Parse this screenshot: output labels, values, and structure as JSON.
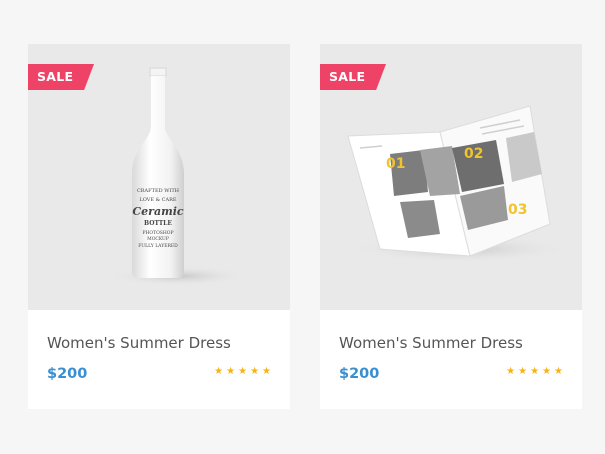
{
  "products": [
    {
      "badge": "SALE",
      "title": "Women's Summer Dress",
      "price": "$200",
      "rating": 5,
      "image": {
        "subject": "ceramic-bottle-mockup",
        "label_lines": [
          "CRAFTED WITH",
          "LOVE & CARE",
          "Ceramic",
          "BOTTLE",
          "PHOTOSHOP",
          "MOCKUP",
          "FULLY LAYERED"
        ]
      }
    },
    {
      "badge": "SALE",
      "title": "Women's Summer Dress",
      "price": "$200",
      "rating": 5,
      "image": {
        "subject": "open-magazine-mockup",
        "numbers": [
          "01",
          "02",
          "03"
        ]
      }
    }
  ],
  "colors": {
    "badge": "#ee4266",
    "price": "#3a8fd0",
    "star": "#f4b41a",
    "magazine_number": "#f0c330"
  }
}
